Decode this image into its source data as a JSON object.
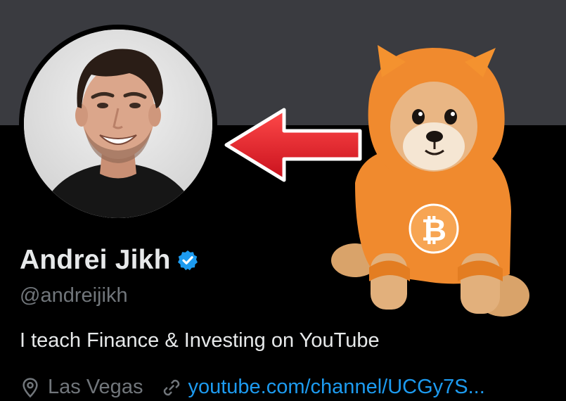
{
  "profile": {
    "display_name": "Andrei Jikh",
    "verified_icon": "verified-badge-icon",
    "handle": "@andreijikh",
    "bio": "I teach Finance & Investing on YouTube",
    "location": "Las Vegas",
    "website": "youtube.com/channel/UCGy7S..."
  },
  "icons": {
    "location": "location-pin-icon",
    "link": "link-icon",
    "arrow": "red-arrow-left-icon"
  },
  "colors": {
    "banner": "#3a3b40",
    "background": "#000000",
    "name_text": "#e7e9ea",
    "secondary_text": "#71767b",
    "link": "#1d9bf0",
    "verified": "#1d9bf0",
    "arrow": "#e8202a",
    "hoodie": "#f08a2e"
  }
}
